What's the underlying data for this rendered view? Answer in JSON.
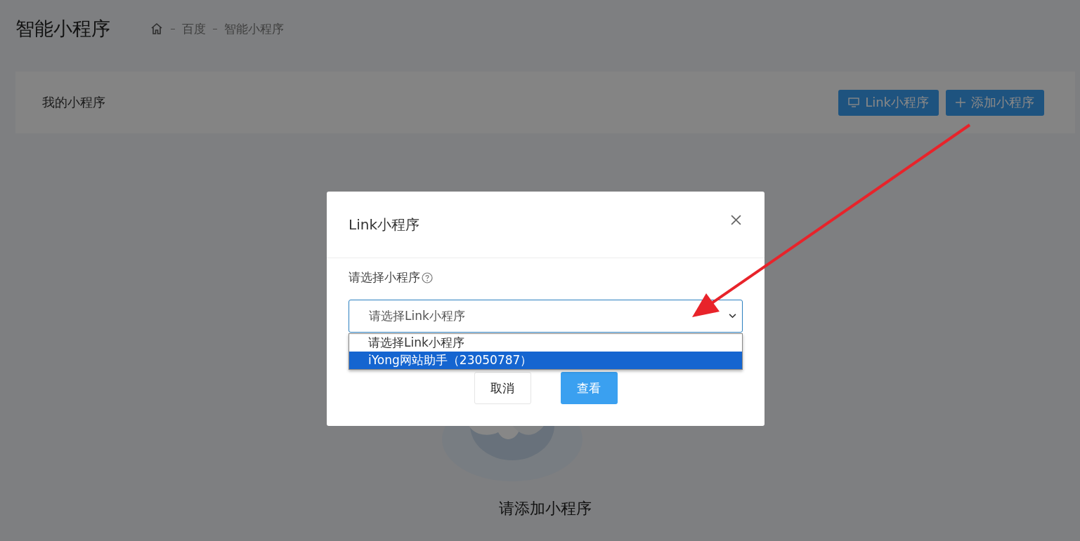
{
  "page": {
    "title": "智能小程序",
    "breadcrumb": [
      "百度",
      "智能小程序"
    ]
  },
  "card": {
    "title": "我的小程序",
    "buttons": [
      {
        "kind": "link",
        "label": "Link小程序"
      },
      {
        "kind": "add",
        "label": "添加小程序"
      }
    ]
  },
  "empty_state": {
    "message": "请添加小程序"
  },
  "dialog": {
    "title": "Link小程序",
    "field_label": "请选择小程序",
    "select": {
      "value": "请选择Link小程序",
      "expanded": true,
      "options": [
        {
          "label": "请选择Link小程序",
          "highlighted": false
        },
        {
          "label": "iYong网站助手（23050787）",
          "highlighted": true
        }
      ]
    },
    "buttons": [
      {
        "kind": "cancel",
        "label": "取消"
      },
      {
        "kind": "primary",
        "label": "查看"
      }
    ]
  }
}
